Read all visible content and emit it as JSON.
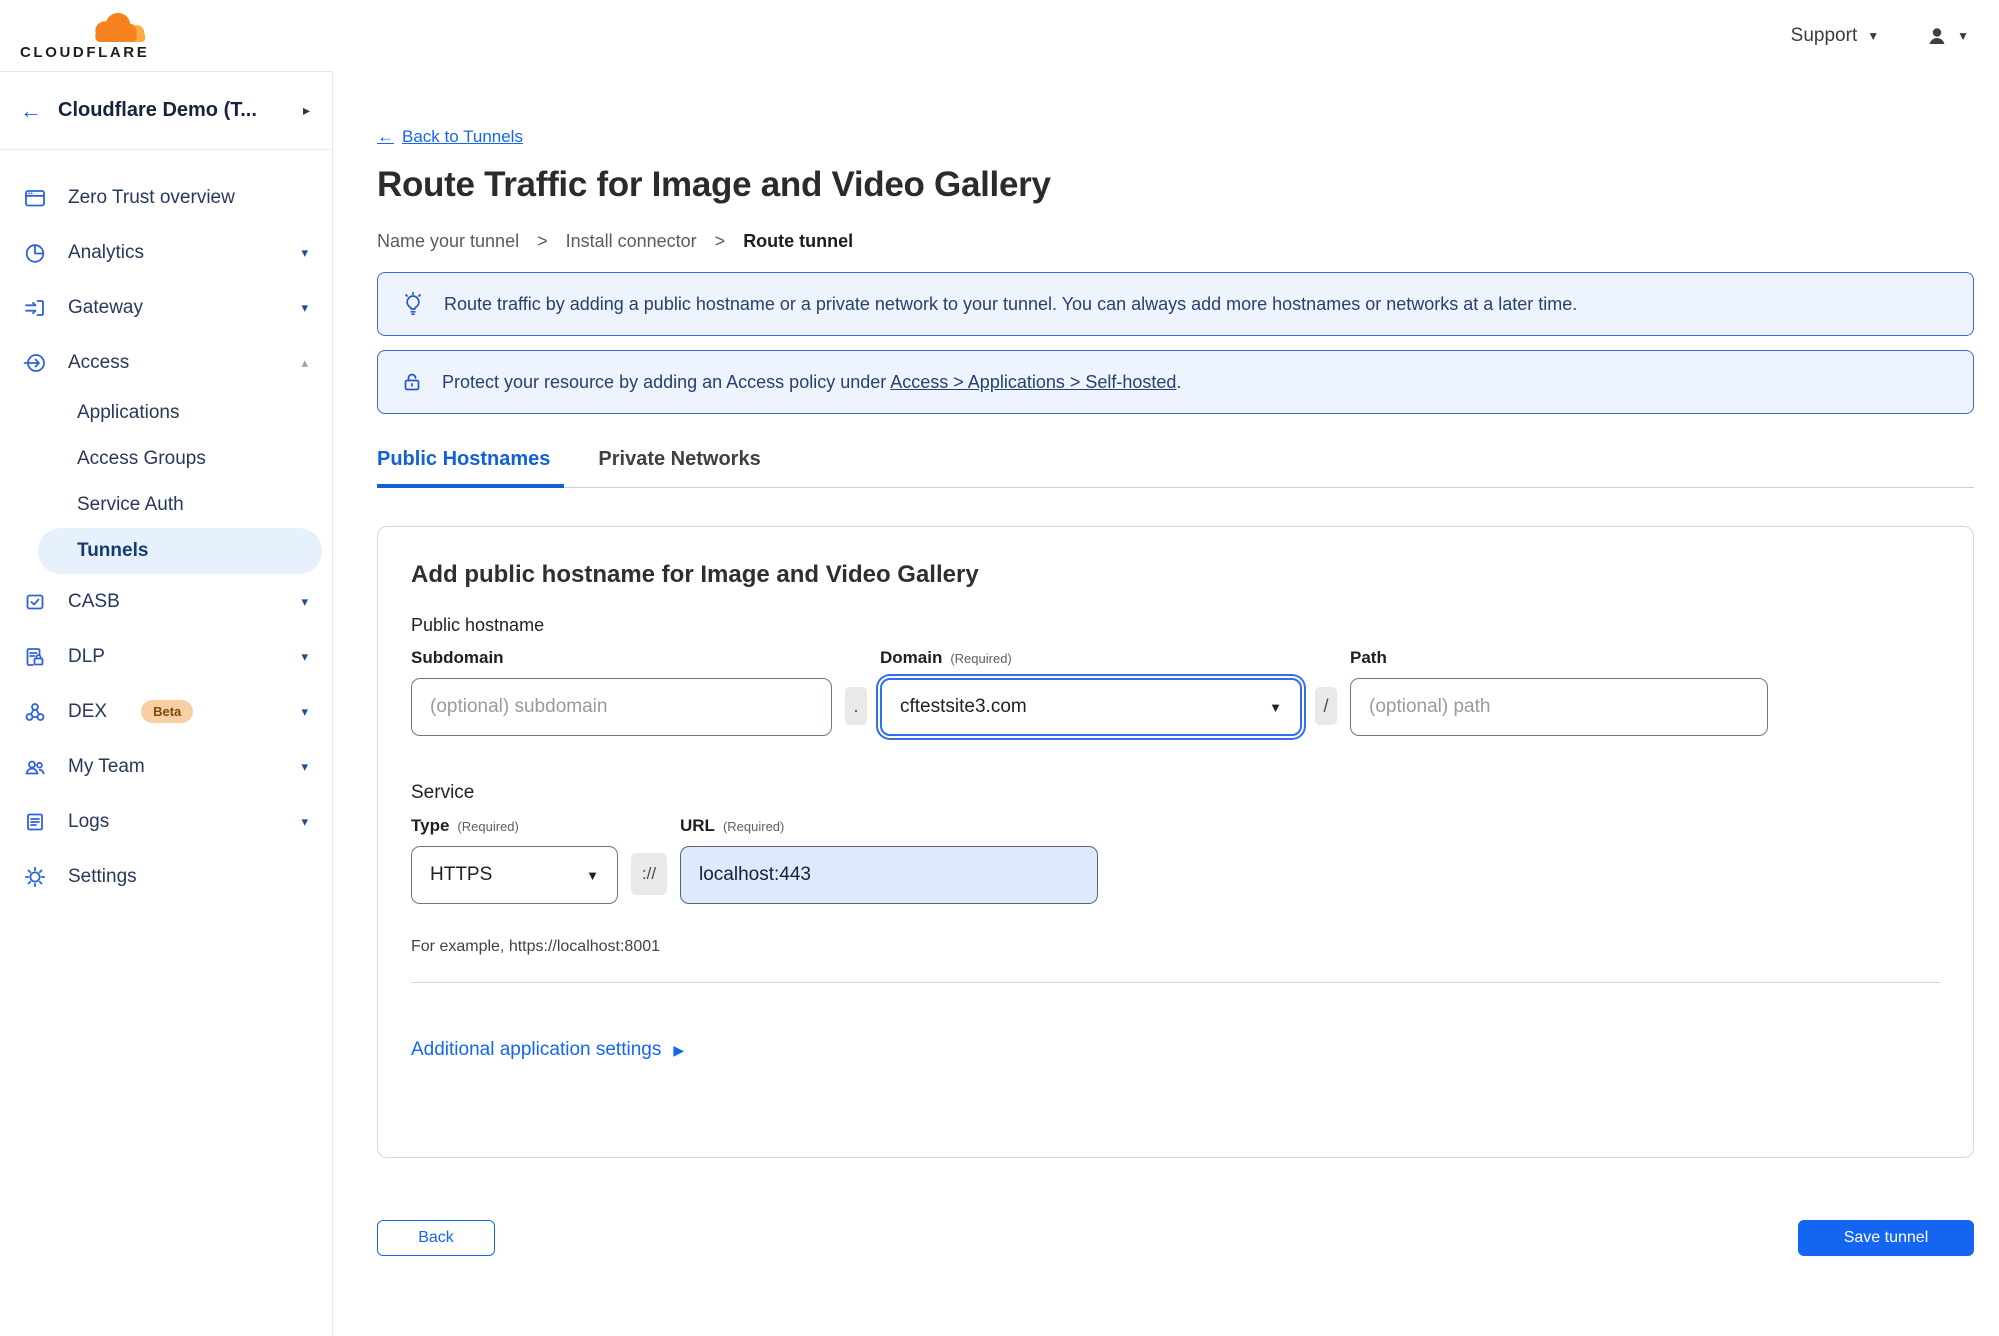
{
  "colors": {
    "accent": "#1466F2",
    "banner_bg": "#EDF4FD",
    "banner_border": "#3B6BCB",
    "sidebar_selected_bg": "#E7F1FC",
    "beta_badge_bg": "#F8CFA3",
    "url_filled_bg": "#DDE9FC"
  },
  "icons": {
    "back_arrow": "←",
    "chevron_right": "▸",
    "caret_down": "▾",
    "caret_up": "▴",
    "dropdown": "▼",
    "play": "▶",
    "gt": ">"
  },
  "topbar": {
    "support_label": "Support"
  },
  "sidebar": {
    "account_name": "Cloudflare Demo (T...",
    "logo_text": "CLOUDFLARE",
    "items": [
      {
        "label": "Zero Trust overview"
      },
      {
        "label": "Analytics"
      },
      {
        "label": "Gateway"
      },
      {
        "label": "Access"
      },
      {
        "label": "CASB"
      },
      {
        "label": "DLP"
      },
      {
        "label": "DEX",
        "badge": "Beta"
      },
      {
        "label": "My Team"
      },
      {
        "label": "Logs"
      },
      {
        "label": "Settings"
      }
    ],
    "access_children": [
      {
        "label": "Applications"
      },
      {
        "label": "Access Groups"
      },
      {
        "label": "Service Auth"
      },
      {
        "label": "Tunnels",
        "selected": true
      }
    ]
  },
  "main": {
    "back_link": "Back to Tunnels",
    "title": "Route Traffic for Image and Video Gallery",
    "steps": [
      {
        "label": "Name your tunnel"
      },
      {
        "label": "Install connector"
      },
      {
        "label": "Route tunnel"
      }
    ],
    "banners": {
      "tip": "Route traffic by adding a public hostname or a private network to your tunnel. You can always add more hostnames or networks at a later time.",
      "protect_before": "Protect your resource by adding an Access policy under ",
      "protect_link": "Access > Applications > Self-hosted",
      "protect_after": "."
    },
    "tabs": [
      {
        "label": "Public Hostnames"
      },
      {
        "label": "Private Networks"
      }
    ],
    "form": {
      "heading": "Add public hostname for Image and Video Gallery",
      "group_label": "Public hostname",
      "subdomain_label": "Subdomain",
      "subdomain_placeholder": "(optional) subdomain",
      "dot": ".",
      "domain_label": "Domain",
      "domain_required": "(Required)",
      "domain_value": "cftestsite3.com",
      "slash": "/",
      "path_label": "Path",
      "path_placeholder": "(optional) path",
      "service_label": "Service",
      "type_label": "Type",
      "type_required": "(Required)",
      "type_value": "HTTPS",
      "protocol": "://",
      "url_label": "URL",
      "url_required": "(Required)",
      "url_value": "localhost:443",
      "example": "For example, https://localhost:8001",
      "additional_settings": "Additional application settings"
    },
    "footer": {
      "back": "Back",
      "save": "Save tunnel"
    }
  }
}
